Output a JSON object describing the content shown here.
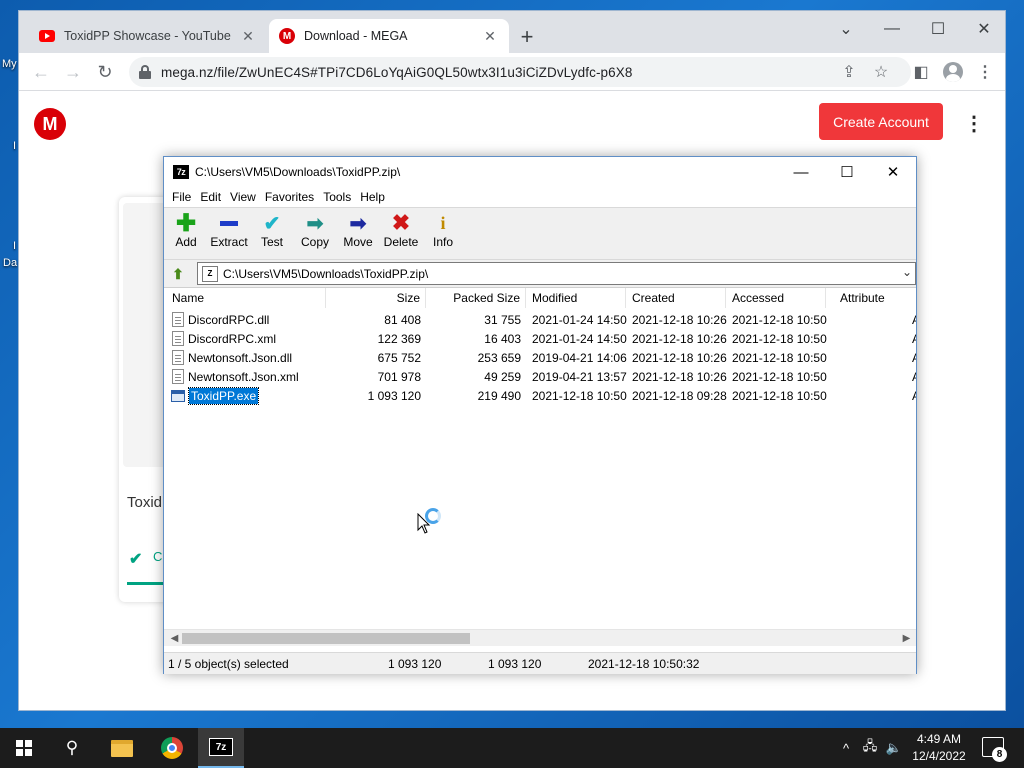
{
  "desktop": {
    "label_1": "My",
    "label_2": "I",
    "label_3": "Da",
    "label_4": "I"
  },
  "browser": {
    "tabs": [
      {
        "title": "ToxidPP Showcase - YouTube",
        "favicon": "youtube-icon"
      },
      {
        "title": "Download - MEGA",
        "favicon": "mega-icon"
      }
    ],
    "url": "mega.nz/file/ZwUnEC4S#TPi7CD6LoYqAiG0QL50wtx3I1u3iCiZDvLydfc-p6X8"
  },
  "mega": {
    "logo": "M",
    "create_account": "Create Account",
    "file_name_partial": "Toxid",
    "status_partial": "C"
  },
  "zip": {
    "title": "C:\\Users\\VM5\\Downloads\\ToxidPP.zip\\",
    "menu": [
      "File",
      "Edit",
      "View",
      "Favorites",
      "Tools",
      "Help"
    ],
    "tools": [
      "Add",
      "Extract",
      "Test",
      "Copy",
      "Move",
      "Delete",
      "Info"
    ],
    "address": "C:\\Users\\VM5\\Downloads\\ToxidPP.zip\\",
    "columns": [
      "Name",
      "Size",
      "Packed Size",
      "Modified",
      "Created",
      "Accessed",
      "Attribute"
    ],
    "rows": [
      {
        "name": "DiscordRPC.dll",
        "size": "81 408",
        "packed": "31 755",
        "modified": "2021-01-24 14:50",
        "created": "2021-12-18 10:26",
        "accessed": "2021-12-18 10:50",
        "attr": "A"
      },
      {
        "name": "DiscordRPC.xml",
        "size": "122 369",
        "packed": "16 403",
        "modified": "2021-01-24 14:50",
        "created": "2021-12-18 10:26",
        "accessed": "2021-12-18 10:50",
        "attr": "A"
      },
      {
        "name": "Newtonsoft.Json.dll",
        "size": "675 752",
        "packed": "253 659",
        "modified": "2019-04-21 14:06",
        "created": "2021-12-18 10:26",
        "accessed": "2021-12-18 10:50",
        "attr": "A"
      },
      {
        "name": "Newtonsoft.Json.xml",
        "size": "701 978",
        "packed": "49 259",
        "modified": "2019-04-21 13:57",
        "created": "2021-12-18 10:26",
        "accessed": "2021-12-18 10:50",
        "attr": "A"
      },
      {
        "name": "ToxidPP.exe",
        "size": "1 093 120",
        "packed": "219 490",
        "modified": "2021-12-18 10:50",
        "created": "2021-12-18 09:28",
        "accessed": "2021-12-18 10:50",
        "attr": "A"
      }
    ],
    "status": {
      "selected": "1 / 5 object(s) selected",
      "size": "1 093 120",
      "packed": "1 093 120",
      "modified": "2021-12-18 10:50:32"
    }
  },
  "taskbar": {
    "time": "4:49 AM",
    "date": "12/4/2022",
    "notification_count": "8",
    "sz_label": "7z"
  }
}
